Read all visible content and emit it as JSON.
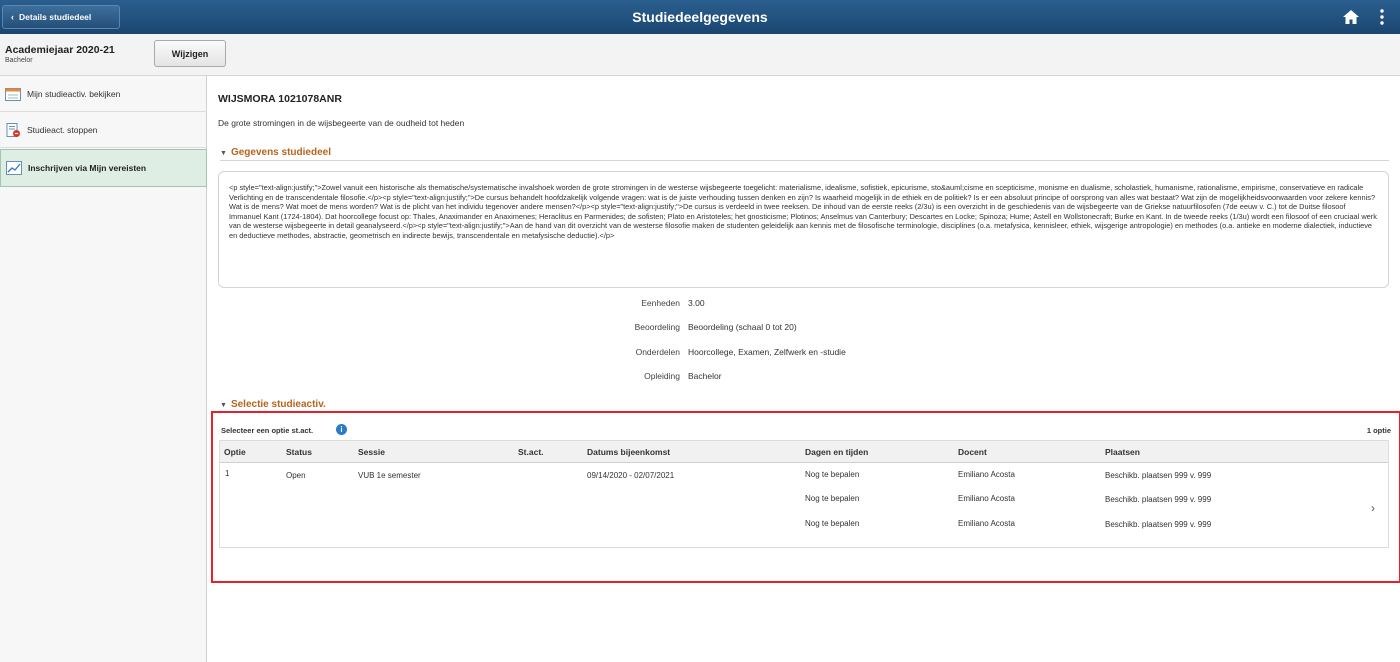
{
  "header": {
    "back_label": "Details studiedeel",
    "title": "Studiedeelgegevens",
    "icons": [
      "home-icon",
      "kebab-menu-icon"
    ]
  },
  "subheader": {
    "academic_year": "Academiejaar 2020-21",
    "level": "Bachelor",
    "change_label": "Wijzigen"
  },
  "sidebar": {
    "items": [
      {
        "label": "Mijn studieactiv. bekijken",
        "icon": "calendar-icon",
        "active": false
      },
      {
        "label": "Studieact. stoppen",
        "icon": "stop-icon",
        "active": false
      },
      {
        "label": "Inschrijven via Mijn vereisten",
        "icon": "chart-icon",
        "active": true
      }
    ]
  },
  "course": {
    "code": "WIJSMORA 1021078ANR",
    "description": "De grote stromingen in de wijsbegeerte van de oudheid tot heden"
  },
  "details_section": {
    "title": "Gegevens studiedeel",
    "description_html": "<p style=\"text-align:justify;\">Zowel vanuit een historische als thematische/systematische invalshoek worden de grote stromingen in de westerse wijsbegeerte toegelicht: materialisme, idealisme, sofistiek, epicurisme, sto&auml;cisme en scepticisme, monisme en dualisme, scholastiek, humanisme, rationalisme, empirisme, conservatieve en radicale Verlichting en de transcendentale filosofie.</p><p style=\"text-align:justify;\">De cursus behandelt hoofdzakelijk volgende vragen: wat is de juiste verhouding tussen denken en zijn? Is waarheid mogelijk in de ethiek en de politiek? Is er een absoluut principe of oorsprong van alles wat bestaat? Wat zijn de mogelijkheidsvoorwaarden voor zekere kennis? Wat is de mens? Wat moet de mens worden? Wat is de plicht van het individu tegenover andere mensen?</p><p style=\"text-align:justify;\">De cursus is verdeeld in twee reeksen. De inhoud van de eerste reeks (2/3u) is een overzicht in de geschiedenis van de wijsbegeerte van de Griekse natuurfilosofen (7de eeuw v. C.) tot de Duitse filosoof Immanuel Kant (1724-1804). Dat hoorcollege focust op: Thales, Anaximander en Anaximenes; Heraclitus en Parmenides; de sofisten; Plato en Aristoteles; het gnosticisme; Plotinos; Anselmus van Canterbury; Descartes en Locke; Spinoza; Hume; Astell en Wollstonecraft; Burke en Kant. In de tweede reeks (1/3u) wordt een filosoof of een cruciaal werk van de westerse wijsbegeerte in detail geanalyseerd.</p><p style=\"text-align:justify;\">Aan de hand van dit overzicht van de westerse filosofie maken de studenten geleidelijk aan kennis met de filosofische terminologie, disciplines (o.a. metafysica, kennisleer, ethiek, wijsgerige antropologie) en methodes (o.a. antieke en moderne dialectiek, inductieve en deductieve methodes, abstractie, geometrisch en indirecte bewijs, transcendentale en metafysische deductie).</p>",
    "fields": [
      {
        "label": "Eenheden",
        "value": "3.00"
      },
      {
        "label": "Beoordeling",
        "value": "Beoordeling (schaal 0 tot 20)"
      },
      {
        "label": "Onderdelen",
        "value": "Hoorcollege, Examen, Zelfwerk en -studie"
      },
      {
        "label": "Opleiding",
        "value": "Bachelor"
      }
    ]
  },
  "selection_section": {
    "title": "Selectie studieactiv.",
    "select_label": "Selecteer een optie st.act.",
    "option_count": "1 optie",
    "columns": [
      "Optie",
      "Status",
      "Sessie",
      "St.act.",
      "Datums bijeenkomst",
      "Dagen en tijden",
      "Docent",
      "Plaatsen"
    ],
    "rows": [
      {
        "option": "1",
        "status": "Open",
        "session": "VUB 1e semester",
        "activity": "",
        "dates": "09/14/2020 - 02/07/2021",
        "meetings": [
          {
            "days": "Nog te bepalen",
            "instructor": "Emiliano Acosta",
            "seats": "Beschikb. plaatsen 999 v. 999"
          },
          {
            "days": "Nog te bepalen",
            "instructor": "Emiliano Acosta",
            "seats": "Beschikb. plaatsen 999 v. 999"
          },
          {
            "days": "Nog te bepalen",
            "instructor": "Emiliano Acosta",
            "seats": "Beschikb. plaatsen 999 v. 999"
          }
        ]
      }
    ]
  },
  "colors": {
    "header_bg": "#1f4e79",
    "section_title": "#b5651d",
    "active_item_bg": "#dfeee5",
    "highlight_border": "#e8202a"
  }
}
